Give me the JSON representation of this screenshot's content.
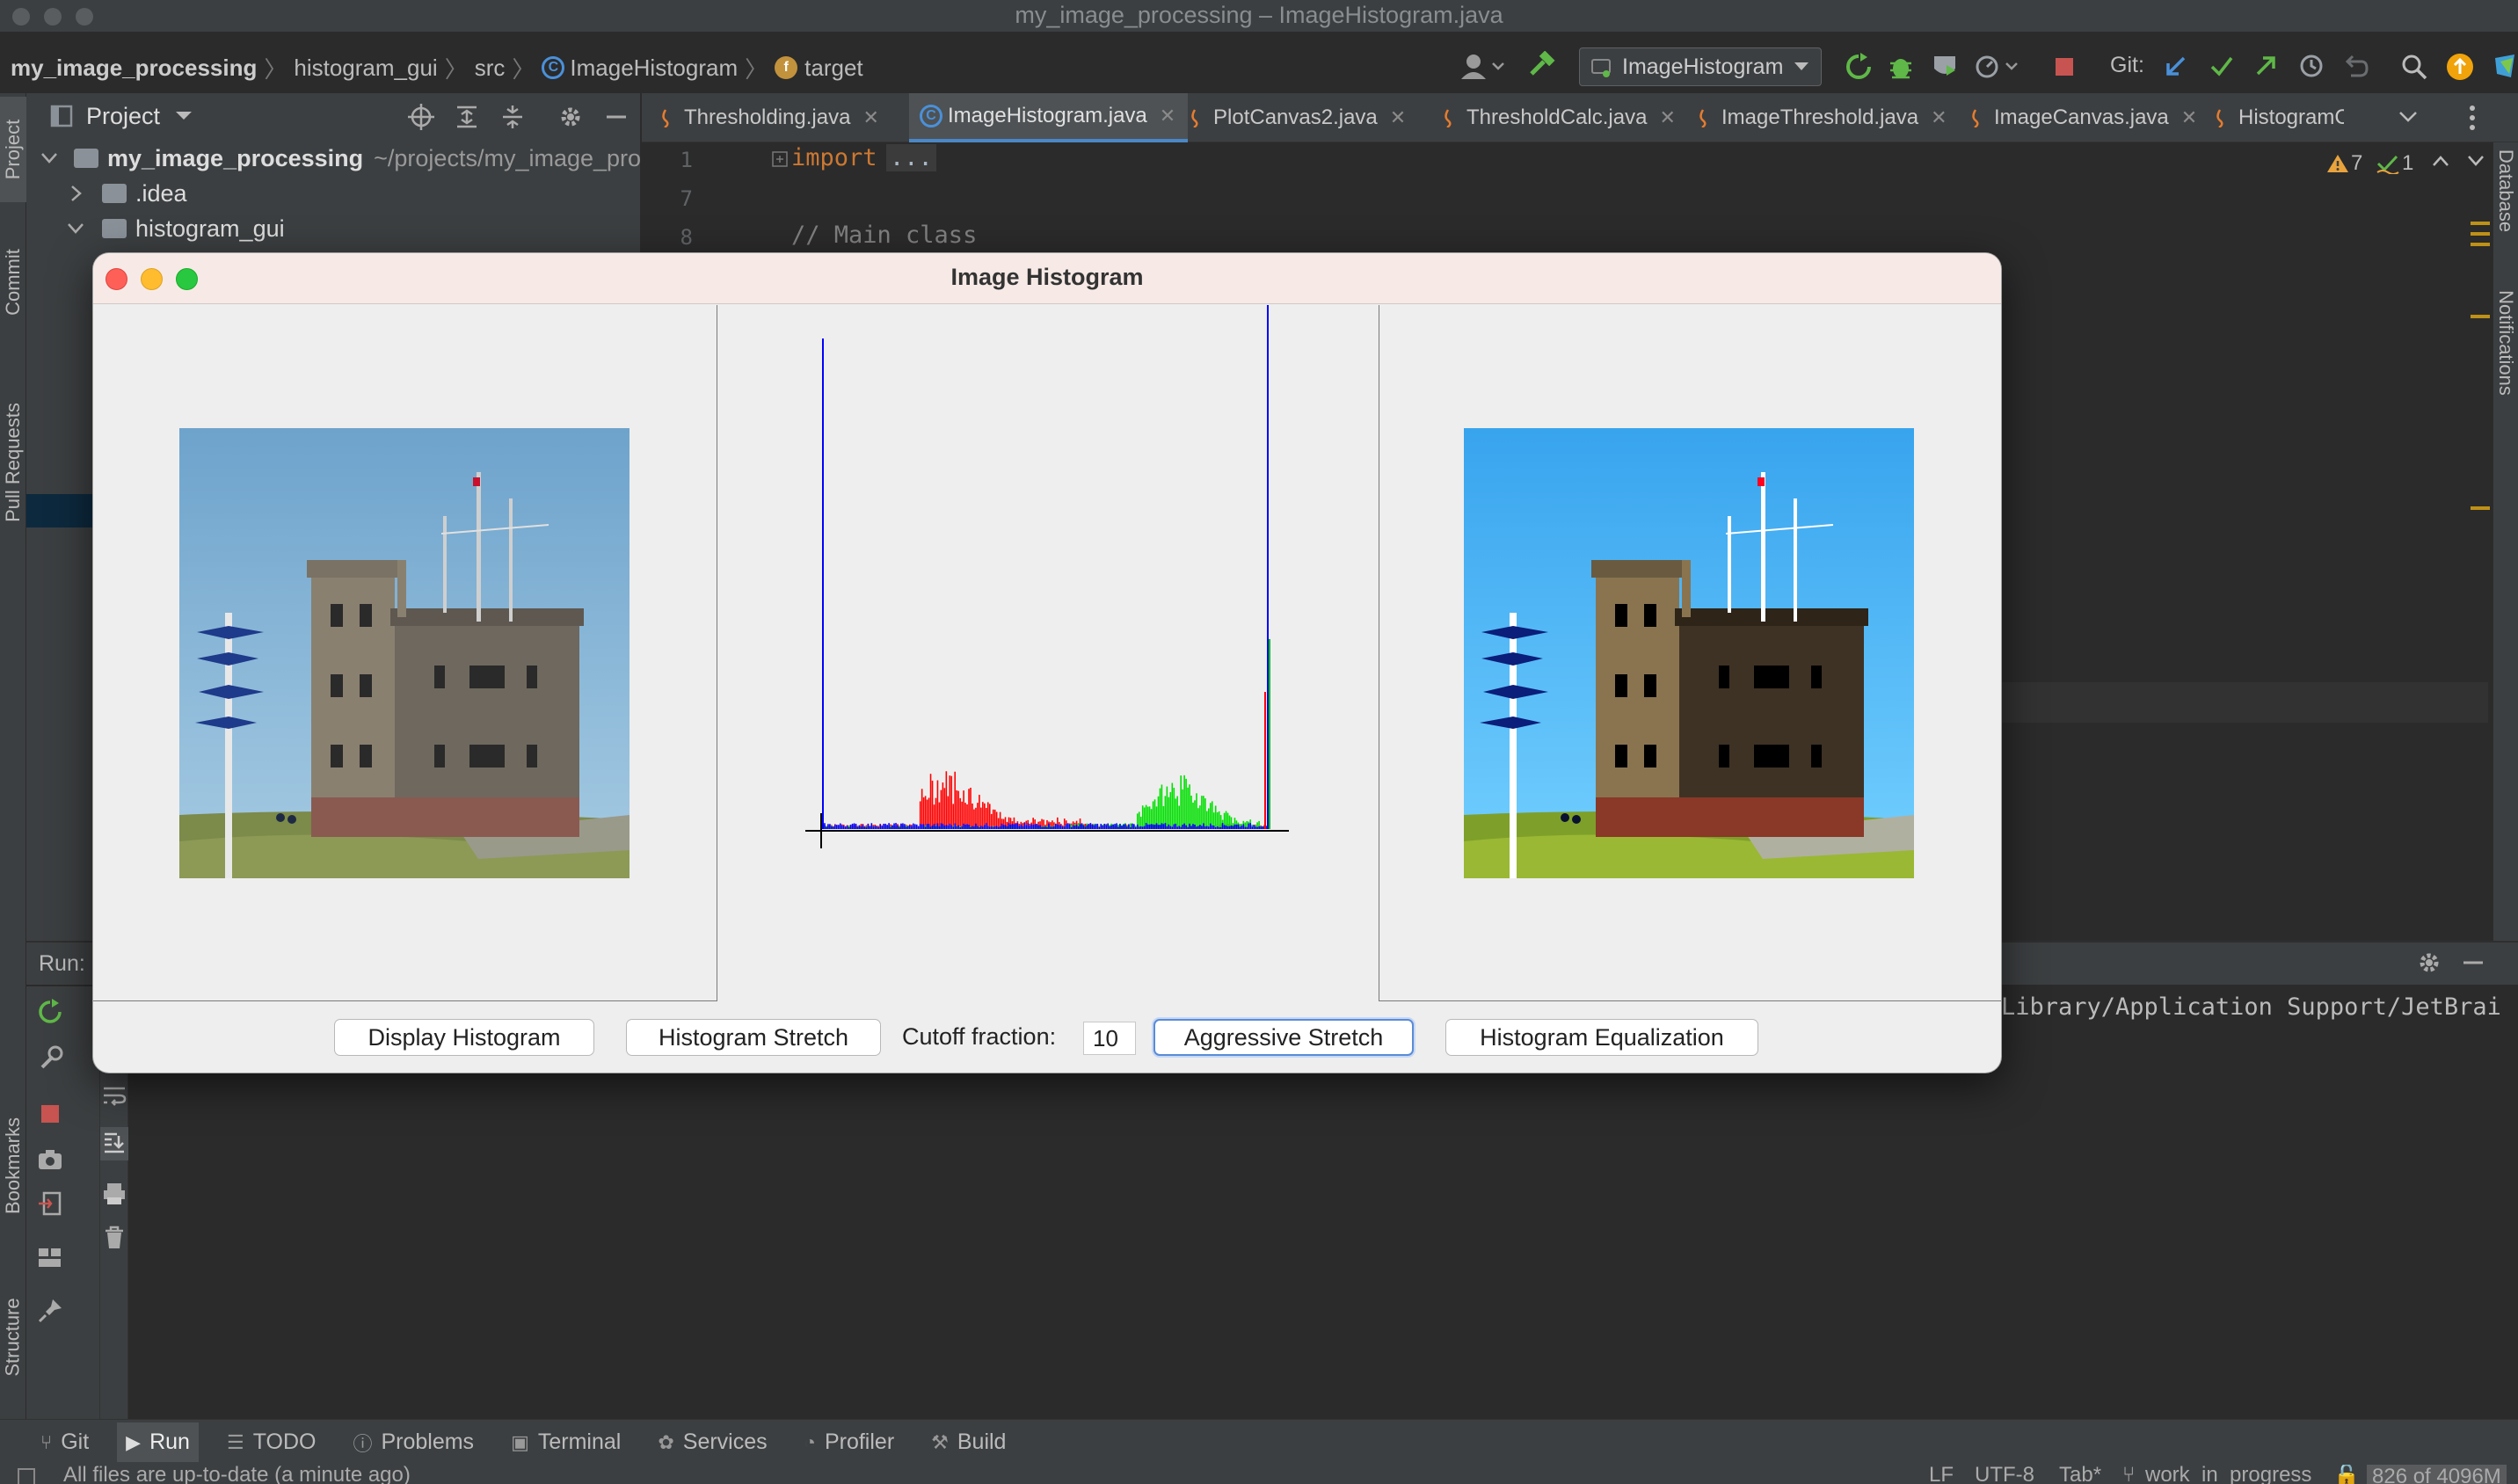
{
  "window": {
    "title": "my_image_processing – ImageHistogram.java"
  },
  "breadcrumb": {
    "project": "my_image_processing",
    "module": "histogram_gui",
    "src": "src",
    "class": "ImageHistogram",
    "field": "target"
  },
  "toolbar": {
    "run_config": "ImageHistogram",
    "git_label": "Git:"
  },
  "project_panel": {
    "title": "Project",
    "root": {
      "name": "my_image_processing",
      "path": "~/projects/my_image_pro"
    },
    "items": [
      {
        "label": ".idea"
      },
      {
        "label": "histogram_gui"
      }
    ]
  },
  "left_strip": {
    "project": "Project",
    "commit": "Commit",
    "pull_requests": "Pull Requests",
    "bookmarks": "Bookmarks",
    "structure": "Structure"
  },
  "right_strip": {
    "database": "Database",
    "notifications": "Notifications"
  },
  "editor": {
    "tabs": [
      {
        "label": "Thresholding.java"
      },
      {
        "label": "ImageHistogram.java"
      },
      {
        "label": "PlotCanvas2.java"
      },
      {
        "label": "ThresholdCalc.java"
      },
      {
        "label": "ImageThreshold.java"
      },
      {
        "label": "ImageCanvas.java"
      },
      {
        "label": "HistogramCalc"
      }
    ],
    "lines": [
      {
        "num": "1",
        "keyword": "import",
        "rest": "..."
      },
      {
        "num": "7",
        "keyword": "",
        "rest": ""
      },
      {
        "num": "8",
        "keyword": "",
        "rest": "// Main class"
      }
    ],
    "warnings": "7",
    "weak_warnings": "1"
  },
  "run_panel": {
    "title": "Run:",
    "output": "Library/Application Support/JetBrai"
  },
  "bottom_tabs": [
    {
      "label": "Git",
      "icon": "git-branch-icon"
    },
    {
      "label": "Run",
      "icon": "play-icon"
    },
    {
      "label": "TODO",
      "icon": "list-icon"
    },
    {
      "label": "Problems",
      "icon": "info-icon"
    },
    {
      "label": "Terminal",
      "icon": "terminal-icon"
    },
    {
      "label": "Services",
      "icon": "services-icon"
    },
    {
      "label": "Profiler",
      "icon": "profiler-icon"
    },
    {
      "label": "Build",
      "icon": "hammer-icon"
    }
  ],
  "status": {
    "message": "All files are up-to-date (a minute ago)",
    "line_sep": "LF",
    "encoding": "UTF-8",
    "indent": "Tab*",
    "branch": "work_in_progress",
    "memory": "826 of 4096M"
  },
  "dialog": {
    "title": "Image Histogram",
    "buttons": {
      "display": "Display Histogram",
      "stretch": "Histogram Stretch",
      "aggressive": "Aggressive Stretch",
      "equalize": "Histogram Equalization"
    },
    "cutoff_label": "Cutoff fraction:",
    "cutoff_value": "10"
  },
  "colors": {
    "red": "#ff0000",
    "green": "#00e000",
    "blue": "#0000ff"
  }
}
